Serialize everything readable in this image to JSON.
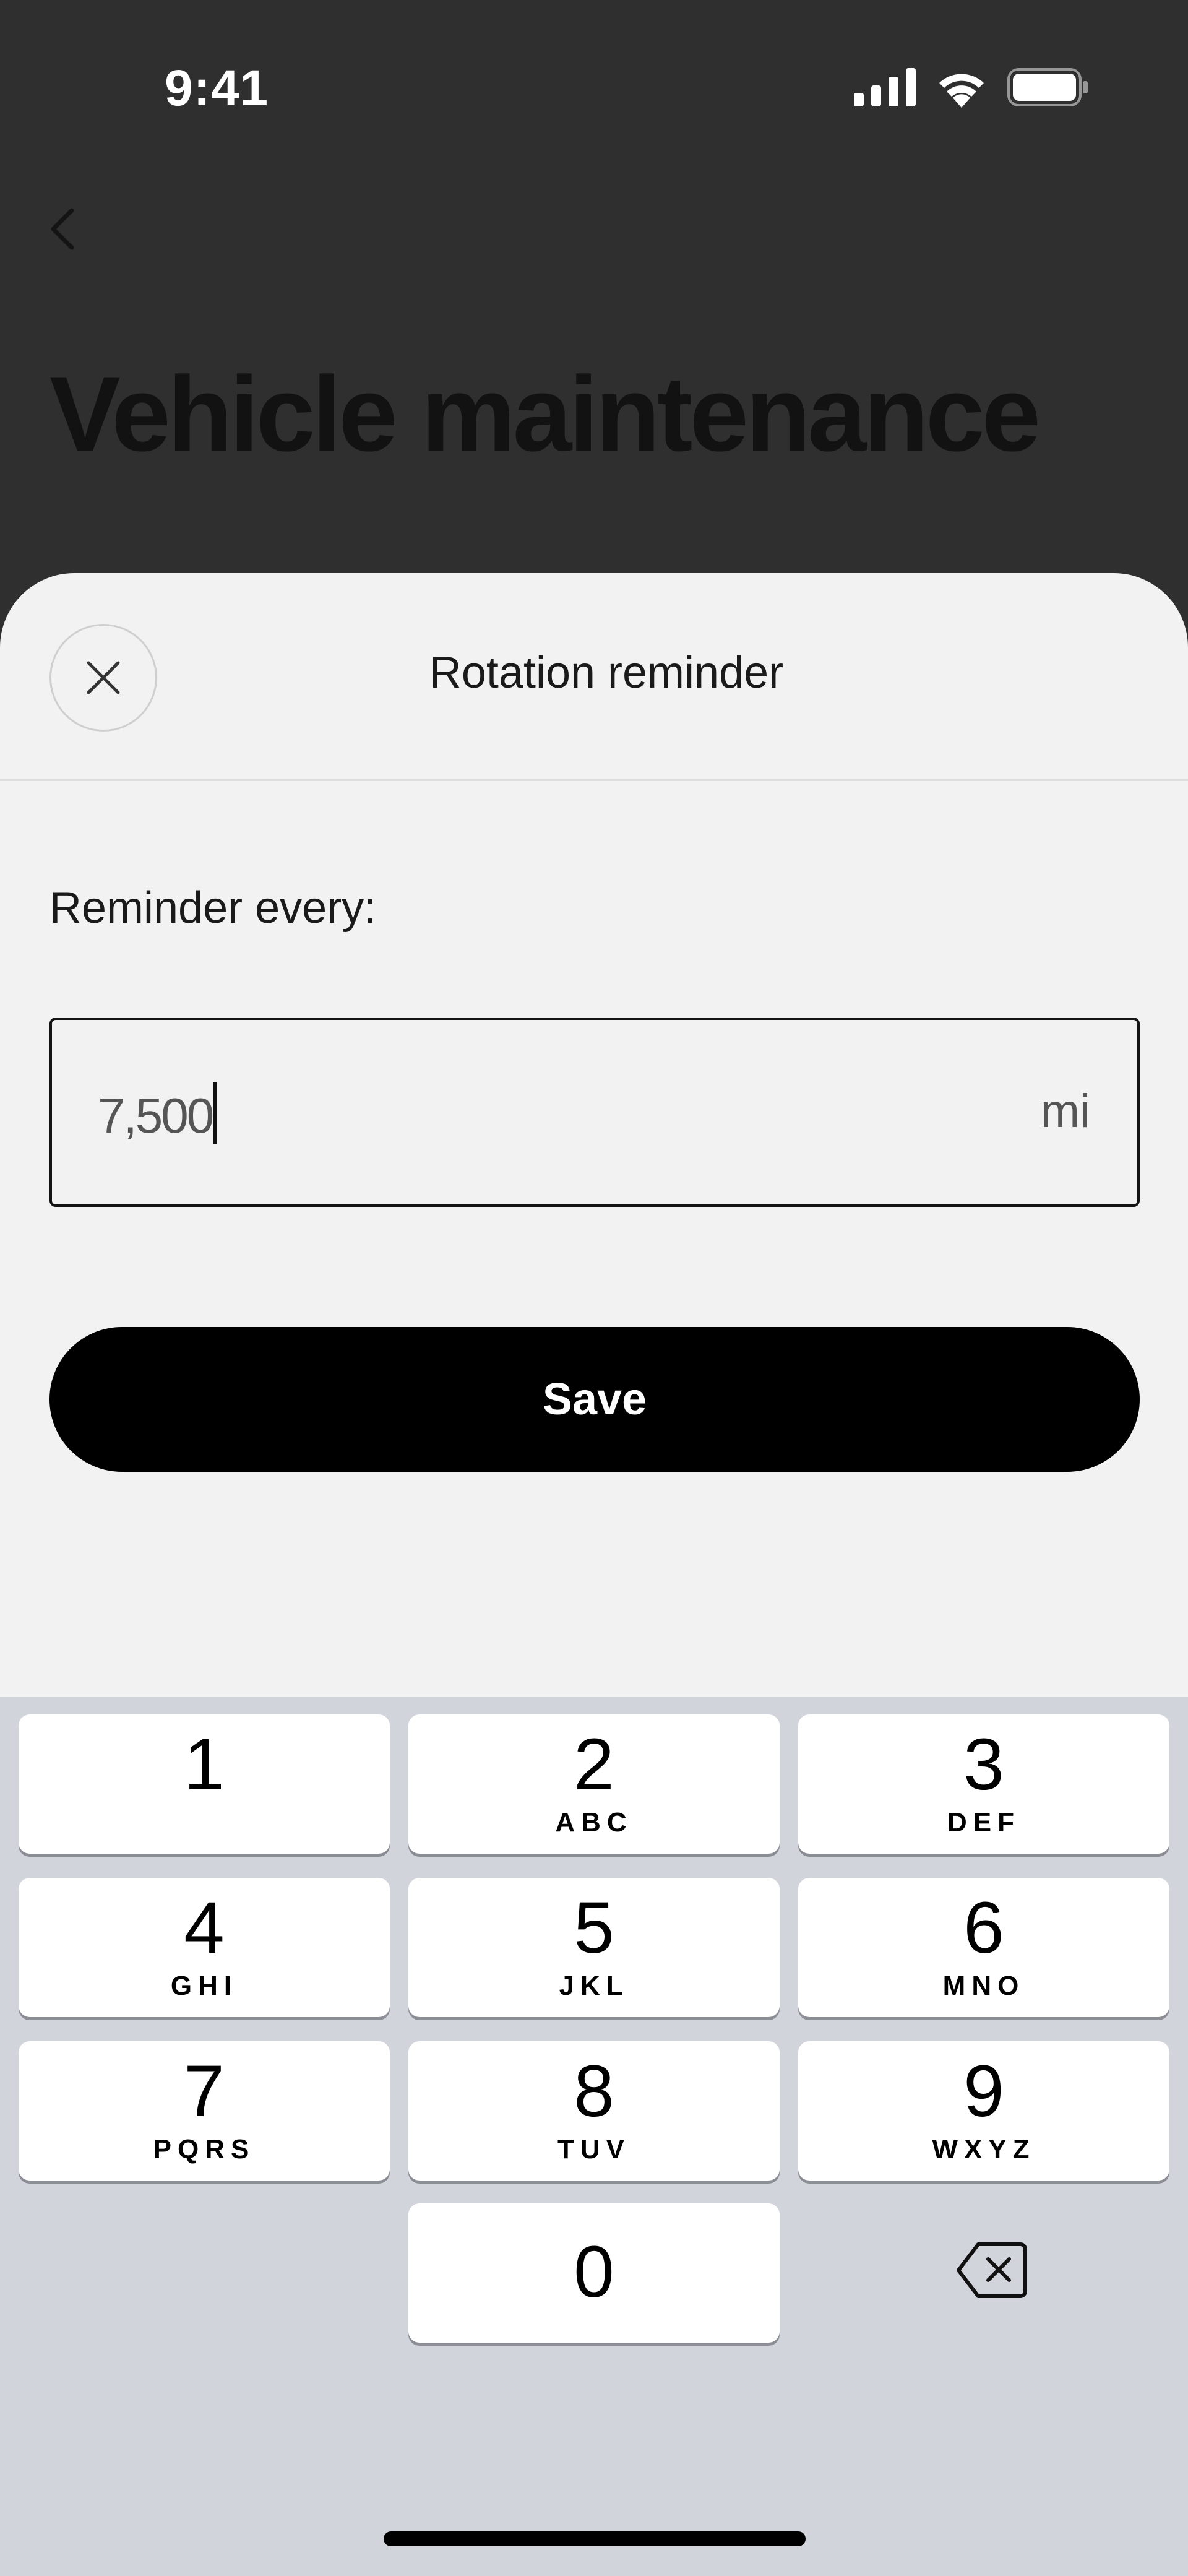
{
  "status_bar": {
    "time": "9:41"
  },
  "background_page": {
    "title": "Vehicle maintenance"
  },
  "sheet": {
    "title": "Rotation reminder",
    "field_label": "Reminder every:",
    "input_value": "7,500",
    "input_unit": "mi",
    "save_label": "Save"
  },
  "keyboard": {
    "keys": [
      {
        "digit": "1",
        "letters": ""
      },
      {
        "digit": "2",
        "letters": "ABC"
      },
      {
        "digit": "3",
        "letters": "DEF"
      },
      {
        "digit": "4",
        "letters": "GHI"
      },
      {
        "digit": "5",
        "letters": "JKL"
      },
      {
        "digit": "6",
        "letters": "MNO"
      },
      {
        "digit": "7",
        "letters": "PQRS"
      },
      {
        "digit": "8",
        "letters": "TUV"
      },
      {
        "digit": "9",
        "letters": "WXYZ"
      },
      {
        "digit": "0",
        "letters": ""
      }
    ]
  },
  "icons": {
    "back": "chevron-left-icon",
    "close": "close-icon",
    "backspace": "backspace-icon",
    "signal": "cellular-signal-icon",
    "wifi": "wifi-icon",
    "battery": "battery-icon"
  }
}
